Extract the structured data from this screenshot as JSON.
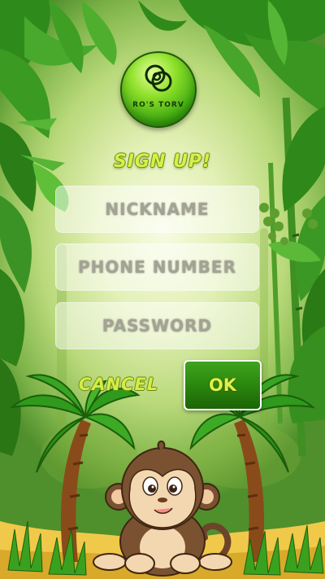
{
  "app": {
    "brand_name": "RO'S TORV"
  },
  "form": {
    "title": "SIGN UP!",
    "nickname_placeholder": "NICKNAME",
    "phone_placeholder": "PHONE NUMBER",
    "password_placeholder": "PASSWORD",
    "cancel_label": "CANCEL",
    "ok_label": "OK"
  },
  "theme": {
    "accent_text": "#d7f04a",
    "button_green": "#2d8a10",
    "logo_green": "#3aa60f"
  },
  "illustration": {
    "scene": "jungle",
    "character": "monkey-icon",
    "plants": [
      "palm-tree-icon",
      "palm-tree-icon",
      "leaf-icon",
      "bamboo-icon"
    ]
  }
}
